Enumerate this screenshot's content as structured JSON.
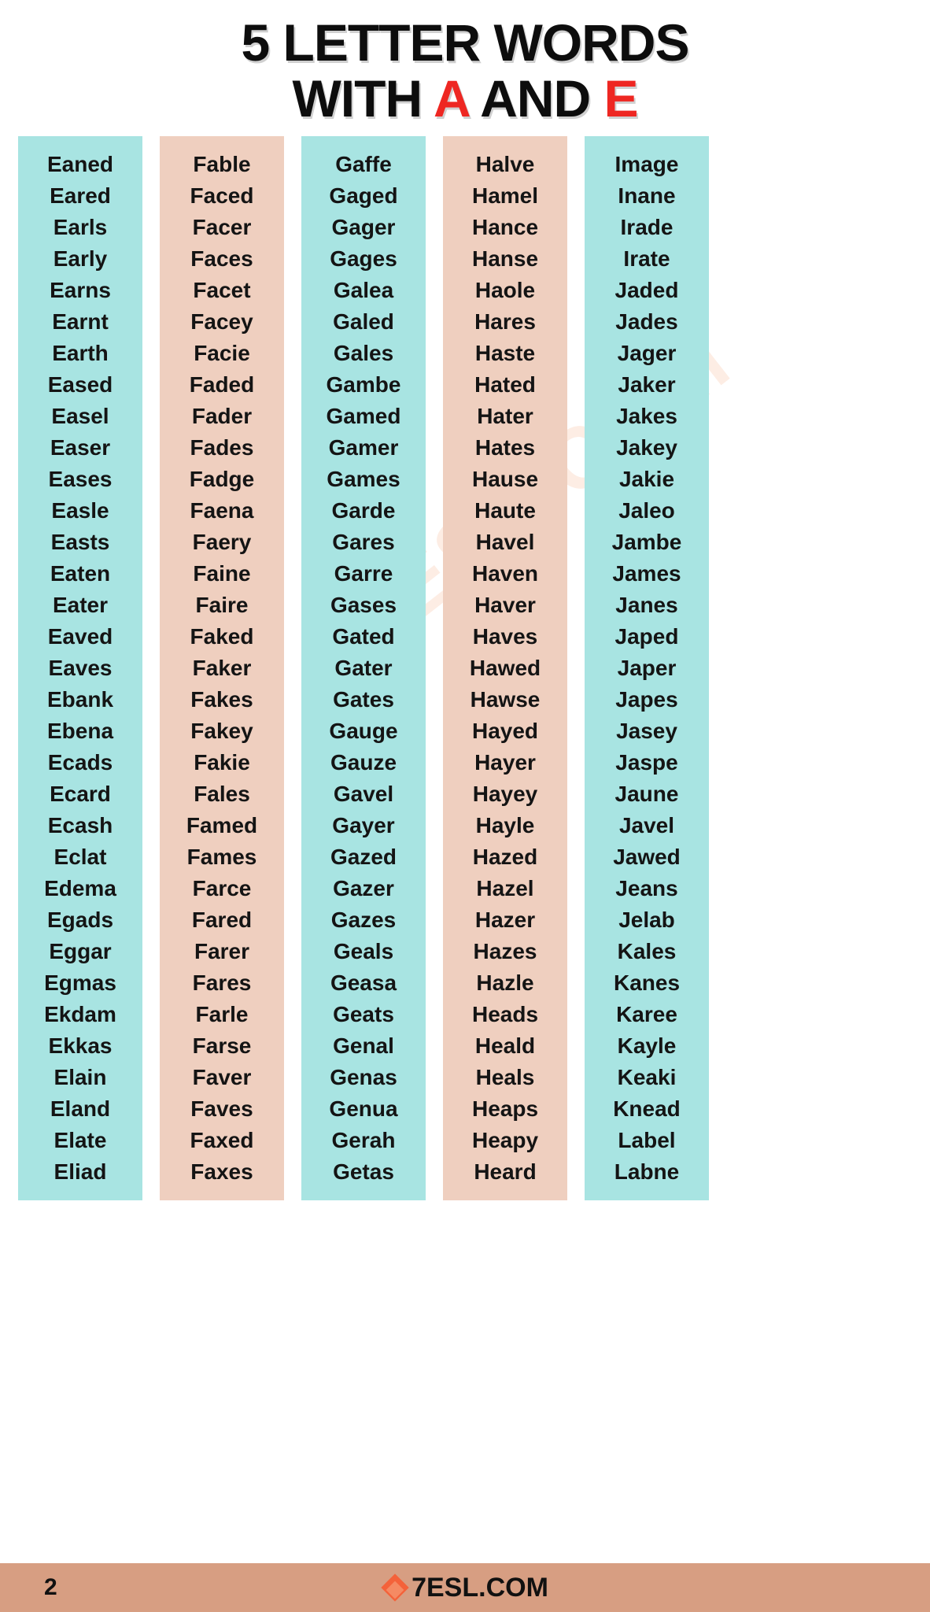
{
  "title": {
    "line1": "5 LETTER WORDS",
    "line2_pre": "WITH ",
    "line2_accent1": "A",
    "line2_mid": " AND ",
    "line2_accent2": "E",
    "accent_color": "#ee2722"
  },
  "watermark": {
    "text": "7ESL.COM"
  },
  "colors": {
    "teal": "#a8e4e2",
    "peach": "#efcfbf",
    "footer": "#d79e82",
    "brand_orange": "#f4623a"
  },
  "columns": [
    {
      "theme": "teal",
      "words": [
        "Eaned",
        "Eared",
        "Earls",
        "Early",
        "Earns",
        "Earnt",
        "Earth",
        "Eased",
        "Easel",
        "Easer",
        "Eases",
        "Easle",
        "Easts",
        "Eaten",
        "Eater",
        "Eaved",
        "Eaves",
        "Ebank",
        "Ebena",
        "Ecads",
        "Ecard",
        "Ecash",
        "Eclat",
        "Edema",
        "Egads",
        "Eggar",
        "Egmas",
        "Ekdam",
        "Ekkas",
        "Elain",
        "Eland",
        "Elate",
        "Eliad"
      ]
    },
    {
      "theme": "peach",
      "words": [
        "Fable",
        "Faced",
        "Facer",
        "Faces",
        "Facet",
        "Facey",
        "Facie",
        "Faded",
        "Fader",
        "Fades",
        "Fadge",
        "Faena",
        "Faery",
        "Faine",
        "Faire",
        "Faked",
        "Faker",
        "Fakes",
        "Fakey",
        "Fakie",
        "Fales",
        "Famed",
        "Fames",
        "Farce",
        "Fared",
        "Farer",
        "Fares",
        "Farle",
        "Farse",
        "Faver",
        "Faves",
        "Faxed",
        "Faxes"
      ]
    },
    {
      "theme": "teal",
      "words": [
        "Gaffe",
        "Gaged",
        "Gager",
        "Gages",
        "Galea",
        "Galed",
        "Gales",
        "Gambe",
        "Gamed",
        "Gamer",
        "Games",
        "Garde",
        "Gares",
        "Garre",
        "Gases",
        "Gated",
        "Gater",
        "Gates",
        "Gauge",
        "Gauze",
        "Gavel",
        "Gayer",
        "Gazed",
        "Gazer",
        "Gazes",
        "Geals",
        "Geasa",
        "Geats",
        "Genal",
        "Genas",
        "Genua",
        "Gerah",
        "Getas"
      ]
    },
    {
      "theme": "peach",
      "words": [
        "Halve",
        "Hamel",
        "Hance",
        "Hanse",
        "Haole",
        "Hares",
        "Haste",
        "Hated",
        "Hater",
        "Hates",
        "Hause",
        "Haute",
        "Havel",
        "Haven",
        "Haver",
        "Haves",
        "Hawed",
        "Hawse",
        "Hayed",
        "Hayer",
        "Hayey",
        "Hayle",
        "Hazed",
        "Hazel",
        "Hazer",
        "Hazes",
        "Hazle",
        "Heads",
        "Heald",
        "Heals",
        "Heaps",
        "Heapy",
        "Heard"
      ]
    },
    {
      "theme": "teal",
      "words": [
        "Image",
        "Inane",
        "Irade",
        "Irate",
        "Jaded",
        "Jades",
        "Jager",
        "Jaker",
        "Jakes",
        "Jakey",
        "Jakie",
        "Jaleo",
        "Jambe",
        "James",
        "Janes",
        "Japed",
        "Japer",
        "Japes",
        "Jasey",
        "Jaspe",
        "Jaune",
        "Javel",
        "Jawed",
        "Jeans",
        "Jelab",
        "Kales",
        "Kanes",
        "Karee",
        "Kayle",
        "Keaki",
        "Knead",
        "Label",
        "Labne"
      ]
    }
  ],
  "footer": {
    "page_number": "2",
    "brand": "7ESL.COM"
  }
}
